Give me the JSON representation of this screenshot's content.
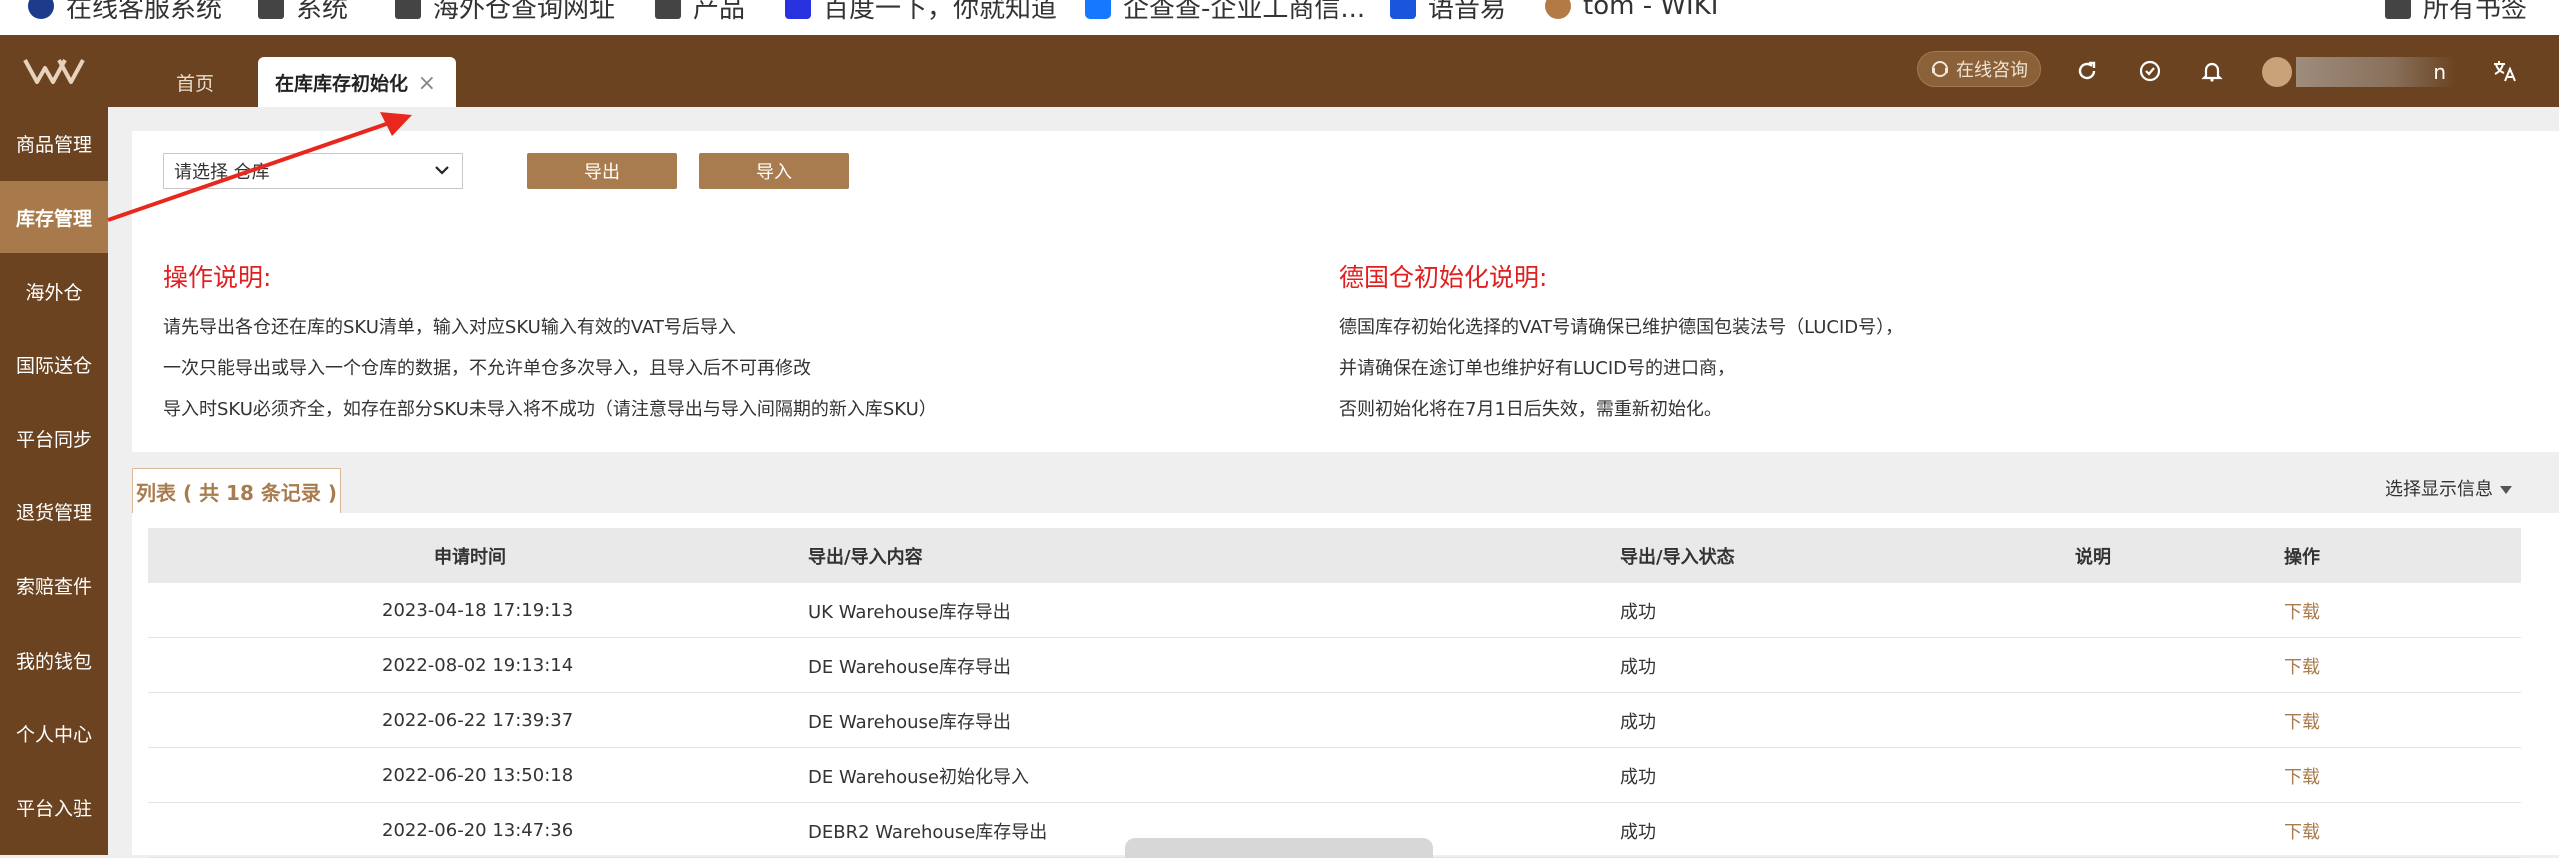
{
  "browser": {
    "bookmarks": [
      {
        "label": "在线客服系统",
        "color": "#1e3a8a"
      },
      {
        "label": "系统",
        "color": "#444444"
      },
      {
        "label": "海外仓查询网址",
        "color": "#444444"
      },
      {
        "label": "产品",
        "color": "#444444"
      },
      {
        "label": "百度一下，你就知道",
        "color": "#2932e1"
      },
      {
        "label": "企查查-企业工商信...",
        "color": "#1677ff"
      },
      {
        "label": "语音易",
        "color": "#1a56db"
      },
      {
        "label": "tom - WIKI",
        "color": "#b47a45"
      },
      {
        "label": "所有书签",
        "color": "#444444"
      }
    ]
  },
  "header": {
    "tabs": [
      {
        "label": "首页"
      },
      {
        "label": "在库库存初始化",
        "close": "×"
      }
    ],
    "consult_label": "在线咨询",
    "user_name": "n"
  },
  "sidebar": {
    "items": [
      {
        "label": "商品管理"
      },
      {
        "label": "库存管理",
        "active": true
      },
      {
        "label": "海外仓"
      },
      {
        "label": "国际送仓"
      },
      {
        "label": "平台同步"
      },
      {
        "label": "退货管理"
      },
      {
        "label": "索赔查件"
      },
      {
        "label": "我的钱包"
      },
      {
        "label": "个人中心"
      },
      {
        "label": "平台入驻"
      }
    ]
  },
  "toolbar": {
    "warehouse_select": "请选择 仓库",
    "export_label": "导出",
    "import_label": "导入"
  },
  "instructions": {
    "left_title": "操作说明:",
    "left_lines": [
      "请先导出各仓还在库的SKU清单，输入对应SKU输入有效的VAT号后导入",
      "一次只能导出或导入一个仓库的数据，不允许单仓多次导入，且导入后不可再修改",
      "导入时SKU必须齐全，如存在部分SKU未导入将不成功（请注意导出与导入间隔期的新入库SKU）"
    ],
    "right_title": "德国仓初始化说明:",
    "right_lines": [
      "德国库存初始化选择的VAT号请确保已维护德国包装法号（LUCID号），",
      "并请确保在途订单也维护好有LUCID号的进口商，",
      "否则初始化将在7月1日后失效，需重新初始化。"
    ]
  },
  "list": {
    "tab_label": "列表 ( 共 18 条记录 )",
    "display_info": "选择显示信息",
    "columns": [
      "申请时间",
      "导出/导入内容",
      "导出/导入状态",
      "说明",
      "操作"
    ],
    "rows": [
      {
        "time": "2023-04-18 17:19:13",
        "content": "UK Warehouse库存导出",
        "status": "成功",
        "note": "",
        "action": "下载"
      },
      {
        "time": "2022-08-02 19:13:14",
        "content": "DE Warehouse库存导出",
        "status": "成功",
        "note": "",
        "action": "下载"
      },
      {
        "time": "2022-06-22 17:39:37",
        "content": "DE Warehouse库存导出",
        "status": "成功",
        "note": "",
        "action": "下载"
      },
      {
        "time": "2022-06-20 13:50:18",
        "content": "DE Warehouse初始化导入",
        "status": "成功",
        "note": "",
        "action": "下载"
      },
      {
        "time": "2022-06-20 13:47:36",
        "content": "DEBR2 Warehouse库存导出",
        "status": "成功",
        "note": "",
        "action": "下载"
      }
    ]
  }
}
